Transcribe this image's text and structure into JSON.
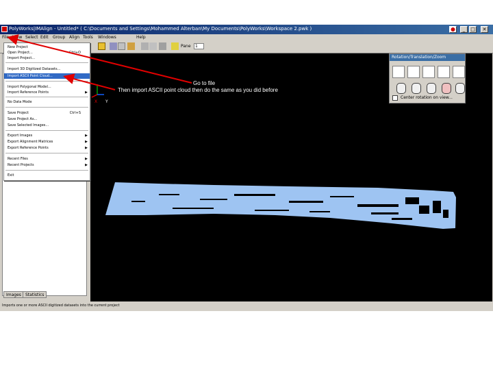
{
  "window": {
    "title": "PolyWorks|IMAlign - Untitled* ( C:\\Documents and Settings\\Mohammed Alterban\\My Documents\\PolyWorks\\Workspace 2.pwk )",
    "buttons": [
      "_",
      "□",
      "✕"
    ]
  },
  "menubar": [
    "File",
    "View",
    "Select",
    "Edit",
    "Group",
    "Align",
    "Tools",
    "Windows",
    "Help"
  ],
  "toolbar": {
    "pane_label": "Pane",
    "pane_value": "1"
  },
  "file_menu": {
    "items": [
      {
        "label": "New Project",
        "shortcut": "",
        "arrow": false,
        "highlight": false
      },
      {
        "label": "Open Project...",
        "shortcut": "Ctrl+O",
        "arrow": false,
        "highlight": false
      },
      {
        "label": "Import Project...",
        "shortcut": "",
        "arrow": false,
        "highlight": false
      },
      {
        "label": "Import 3D Digitized Datasets...",
        "shortcut": "",
        "arrow": false,
        "highlight": false
      },
      {
        "label": "Import ASCII Point Cloud...",
        "shortcut": "",
        "arrow": false,
        "highlight": true
      },
      {
        "label": "Import Polygonal Model...",
        "shortcut": "",
        "arrow": false,
        "highlight": false
      },
      {
        "label": "Import Reference Points",
        "shortcut": "",
        "arrow": true,
        "highlight": false
      },
      {
        "label": "No Data Mode",
        "shortcut": "",
        "arrow": false,
        "highlight": false
      },
      {
        "label": "Save Project",
        "shortcut": "Ctrl+S",
        "arrow": false,
        "highlight": false
      },
      {
        "label": "Save Project As...",
        "shortcut": "",
        "arrow": false,
        "highlight": false
      },
      {
        "label": "Save Selected Images...",
        "shortcut": "",
        "arrow": false,
        "highlight": false
      },
      {
        "label": "Export Images",
        "shortcut": "",
        "arrow": true,
        "highlight": false
      },
      {
        "label": "Export Alignment Matrices",
        "shortcut": "",
        "arrow": true,
        "highlight": false
      },
      {
        "label": "Export Reference Points",
        "shortcut": "",
        "arrow": true,
        "highlight": false
      },
      {
        "label": "Recent Files",
        "shortcut": "",
        "arrow": true,
        "highlight": false
      },
      {
        "label": "Recent Projects",
        "shortcut": "",
        "arrow": true,
        "highlight": false
      },
      {
        "label": "Exit",
        "shortcut": "",
        "arrow": false,
        "highlight": false
      }
    ]
  },
  "left_panel": {
    "tabs": [
      "Images",
      "Statistics"
    ]
  },
  "status_bar": "Imports one or more ASCII digitized datasets into the current project",
  "rotation_panel": {
    "title": "Rotation/Translation/Zoom",
    "checkbox_label": "Center rotation on view..."
  },
  "axes": {
    "x_label": "X",
    "y_label": "Y"
  },
  "annotation": {
    "line1": "Go to file",
    "line2": "Then import ASCII point cloud then do the same as you did before"
  },
  "colors": {
    "point_cloud": "#9ec4f2",
    "arrow": "#e00000",
    "titlebar": "#0a246a",
    "menu_highlight": "#316ac5"
  }
}
